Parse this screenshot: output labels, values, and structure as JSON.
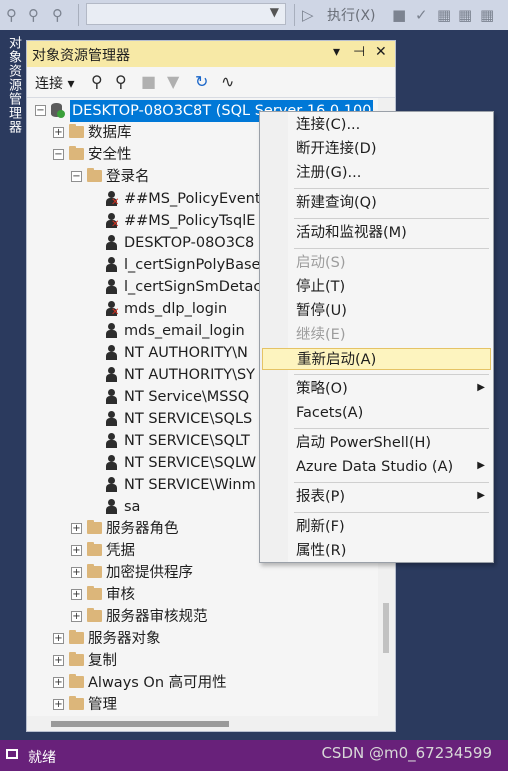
{
  "toolbar": {
    "execute_label": "执行(X)"
  },
  "vertical_tab": {
    "label": "对象资源管理器"
  },
  "panel": {
    "title": "对象资源管理器",
    "pin": "▾ ⊣ ✕"
  },
  "panel_toolbar": {
    "connect_label": "连接"
  },
  "tree": {
    "server": "DESKTOP-08O3C8T (SQL Server 16.0.100",
    "databases": "数据库",
    "security": "安全性",
    "logins": "登录名",
    "login_items": [
      "##MS_PolicyEvent",
      "##MS_PolicyTsqlE",
      "DESKTOP-08O3C8",
      "l_certSignPolyBase",
      "l_certSignSmDetac",
      "mds_dlp_login",
      "mds_email_login",
      "NT AUTHORITY\\N",
      "NT AUTHORITY\\SY",
      "NT Service\\MSSQ",
      "NT SERVICE\\SQLS",
      "NT SERVICE\\SQLT",
      "NT SERVICE\\SQLW",
      "NT SERVICE\\Winm",
      "sa"
    ],
    "security_children": [
      "服务器角色",
      "凭据",
      "加密提供程序",
      "审核",
      "服务器审核规范"
    ],
    "top_children": [
      "服务器对象",
      "复制",
      "Always On 高可用性",
      "管理"
    ]
  },
  "context_menu": {
    "items": [
      {
        "label": "连接(C)...",
        "disabled": false
      },
      {
        "label": "断开连接(D)",
        "disabled": false
      },
      {
        "label": "注册(G)...",
        "disabled": false
      },
      {
        "label": "新建查询(Q)",
        "disabled": false
      },
      {
        "label": "活动和监视器(M)",
        "disabled": false
      },
      {
        "label": "启动(S)",
        "disabled": true
      },
      {
        "label": "停止(T)",
        "disabled": false
      },
      {
        "label": "暂停(U)",
        "disabled": false
      },
      {
        "label": "继续(E)",
        "disabled": true
      },
      {
        "label": "重新启动(A)",
        "disabled": false,
        "highlighted": true
      },
      {
        "label": "策略(O)",
        "disabled": false,
        "submenu": true
      },
      {
        "label": "Facets(A)",
        "disabled": false
      },
      {
        "label": "启动 PowerShell(H)",
        "disabled": false
      },
      {
        "label": "Azure Data Studio (A)",
        "disabled": false,
        "submenu": true
      },
      {
        "label": "报表(P)",
        "disabled": false,
        "submenu": true
      },
      {
        "label": "刷新(F)",
        "disabled": false
      },
      {
        "label": "属性(R)",
        "disabled": false
      }
    ]
  },
  "status_bar": {
    "text": "就绪",
    "watermark": "CSDN @m0_67234599"
  },
  "colors": {
    "status_bg": "#68217a",
    "selection": "#0078d7",
    "panel_title_bg": "#f7e9a6",
    "highlight": "#fdf4bf"
  }
}
